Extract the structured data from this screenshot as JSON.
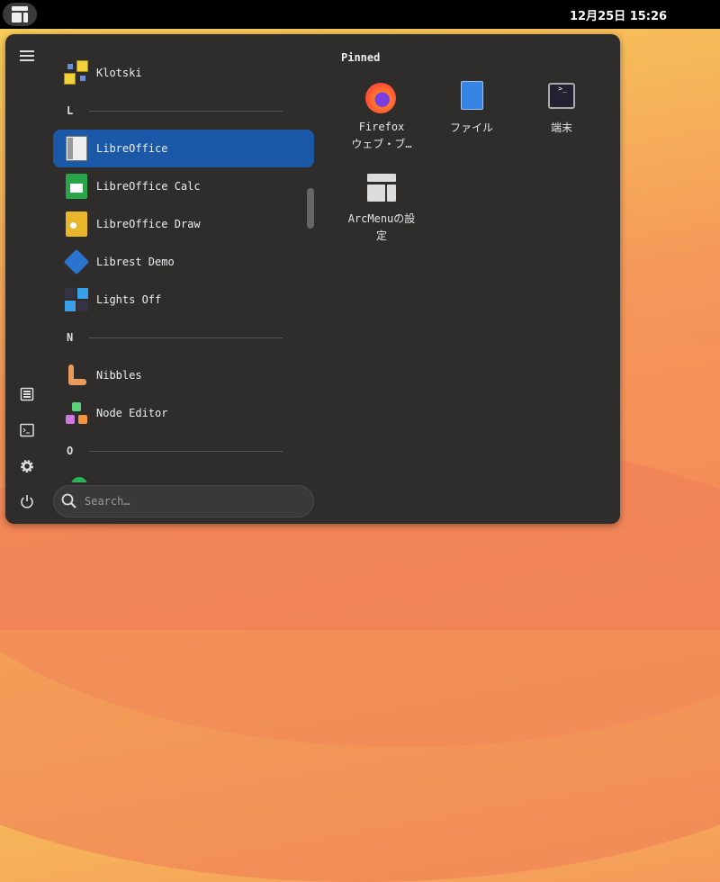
{
  "topbar": {
    "clock": "12月25日 15:26"
  },
  "apps": [
    {
      "label": "Klotski",
      "icon": "klotski-icon"
    },
    {
      "section": "L"
    },
    {
      "label": "LibreOffice",
      "icon": "libreoffice-icon",
      "selected": true
    },
    {
      "label": "LibreOffice Calc",
      "icon": "calc-icon"
    },
    {
      "label": "LibreOffice Draw",
      "icon": "draw-icon"
    },
    {
      "label": "Librest Demo",
      "icon": "librest-icon"
    },
    {
      "label": "Lights Off",
      "icon": "lights-off-icon"
    },
    {
      "section": "N"
    },
    {
      "label": "Nibbles",
      "icon": "nibbles-icon"
    },
    {
      "label": "Node Editor",
      "icon": "node-editor-icon"
    },
    {
      "section": "O"
    }
  ],
  "search": {
    "placeholder": "Search…"
  },
  "pinned": {
    "title": "Pinned",
    "items": [
      {
        "line1": "Firefox",
        "line2": "ウェブ・ブ…"
      },
      {
        "line1": "ファイル"
      },
      {
        "line1": "端末"
      },
      {
        "line1": "ArcMenuの設",
        "line2": "定"
      }
    ]
  }
}
